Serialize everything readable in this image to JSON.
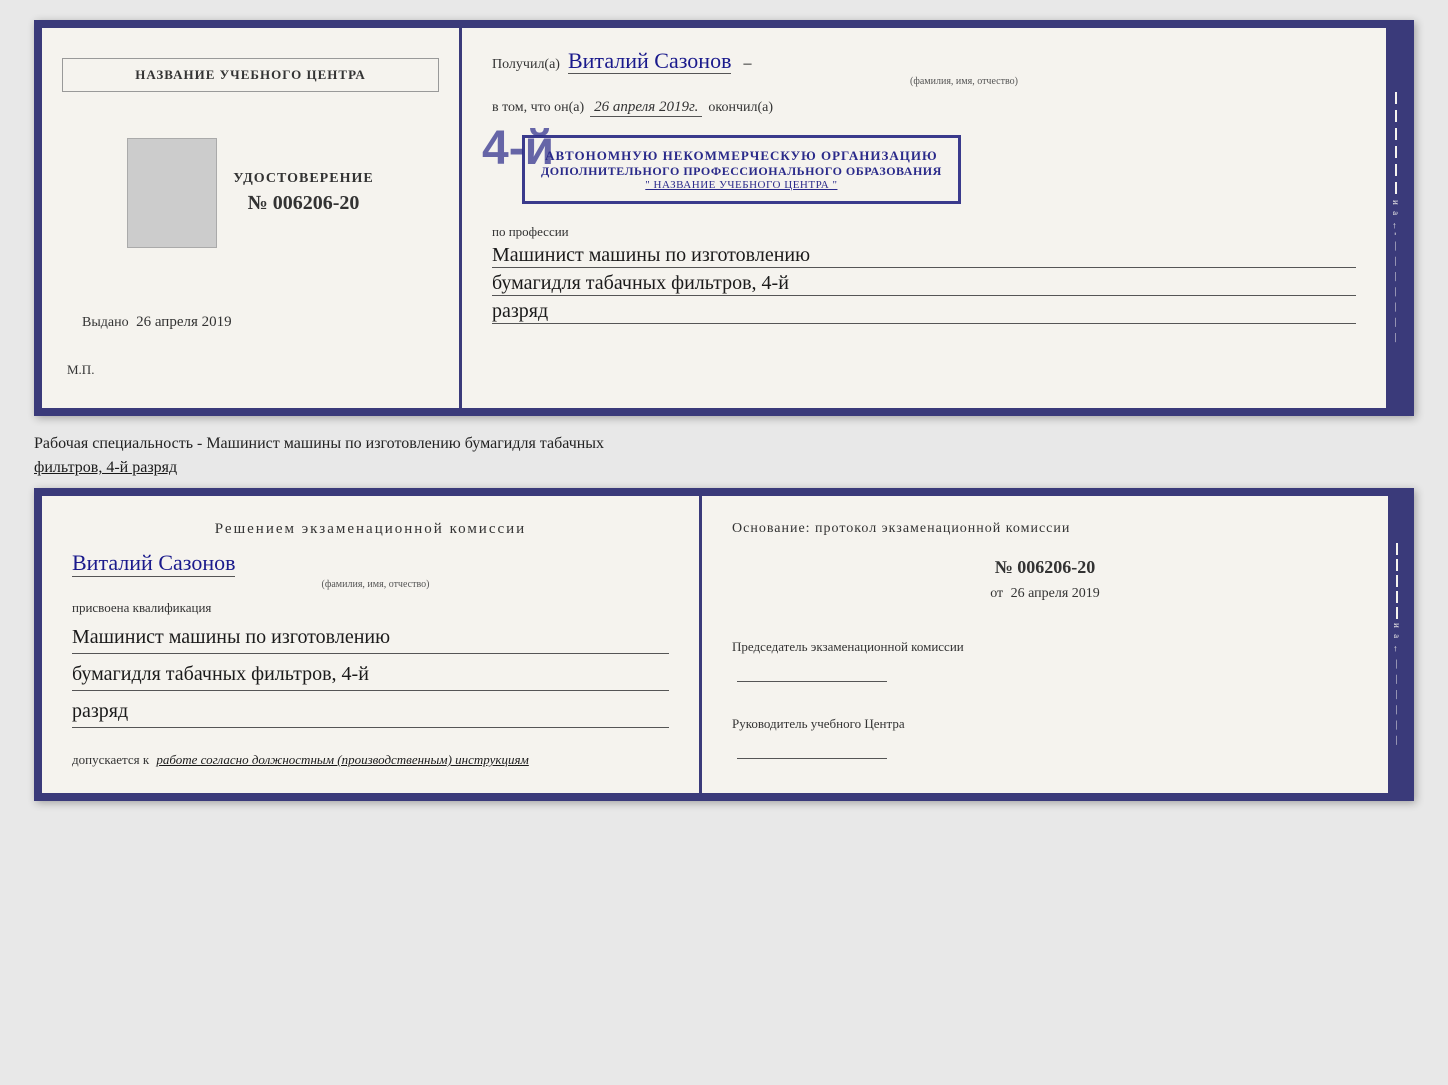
{
  "diploma": {
    "left": {
      "center_name_label": "НАЗВАНИЕ УЧЕБНОГО ЦЕНТРА",
      "udostoverenie_title": "УДОСТОВЕРЕНИЕ",
      "udostoverenie_number": "№ 006206-20",
      "vydano_label": "Выдано",
      "vydano_date": "26 апреля 2019",
      "mp_label": "М.П."
    },
    "right": {
      "poluchil_prefix": "Получил(а)",
      "name_handwritten": "Виталий Сазонов",
      "fio_label": "(фамилия, имя, отчество)",
      "vtom_prefix": "в том, что он(а)",
      "date_handwritten": "26 апреля 2019г.",
      "okonchill": "окончил(а)",
      "stamp_number": "4-й",
      "stamp_line1": "АВТОНОМНУЮ НЕКОММЕРЧЕСКУЮ ОРГАНИЗАЦИЮ",
      "stamp_line2": "ДОПОЛНИТЕЛЬНОГО ПРОФЕССИОНАЛЬНОГО ОБРАЗОВАНИЯ",
      "stamp_line3": "\" НАЗВАНИЕ УЧЕБНОГО ЦЕНТРА \"",
      "po_professii": "по профессии",
      "profession_line1": "Машинист машины по изготовлению",
      "profession_line2": "бумагидля табачных фильтров, 4-й",
      "profession_line3": "разряд"
    }
  },
  "specialty_line": {
    "prefix": "Рабочая специальность - Машинист машины по изготовлению бумагидля табачных",
    "suffix": "фильтров, 4-й разряд"
  },
  "bottom": {
    "left": {
      "reshenie_title": "Решением  экзаменационной  комиссии",
      "name_handwritten": "Виталий Сазонов",
      "fio_label": "(фамилия, имя, отчество)",
      "prisvoena_text": "присвоена квалификация",
      "qualification_line1": "Машинист машины по изготовлению",
      "qualification_line2": "бумагидля табачных фильтров, 4-й",
      "qualification_line3": "разряд",
      "dopuskaetsya_prefix": "допускается к",
      "dopuskaetsya_text": "работе согласно должностным (производственным) инструкциям"
    },
    "right": {
      "osnovanie_text": "Основание: протокол экзаменационной  комиссии",
      "protocol_number": "№  006206-20",
      "ot_prefix": "от",
      "ot_date": "26 апреля 2019",
      "predsedatel_title": "Председатель экзаменационной комиссии",
      "rukovoditel_title": "Руководитель учебного Центра"
    }
  }
}
